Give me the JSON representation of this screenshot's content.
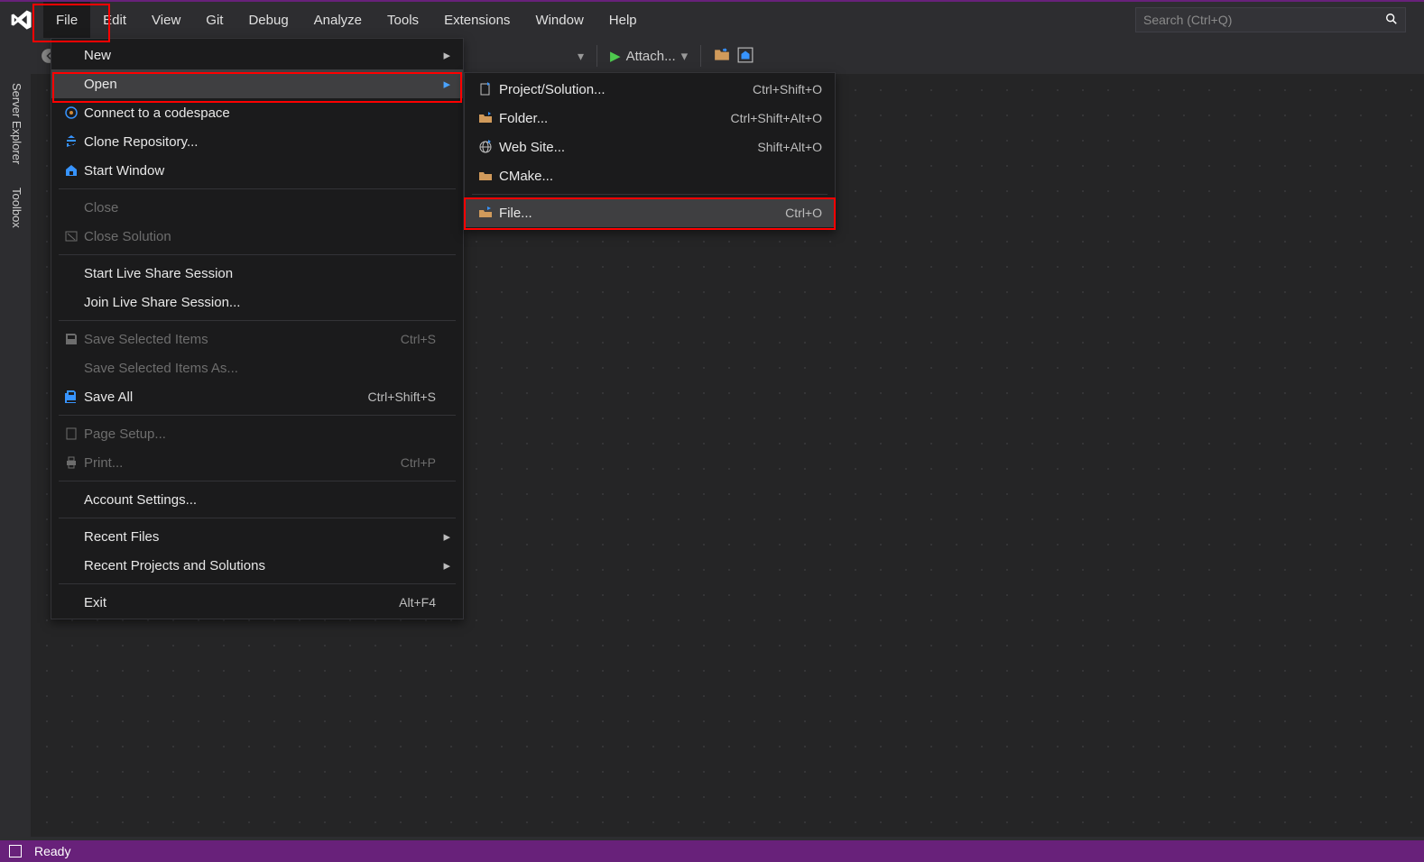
{
  "menubar": {
    "items": [
      "File",
      "Edit",
      "View",
      "Git",
      "Debug",
      "Analyze",
      "Tools",
      "Extensions",
      "Window",
      "Help"
    ],
    "search_placeholder": "Search (Ctrl+Q)"
  },
  "toolstrip": {
    "attach_label": "Attach..."
  },
  "sidetabs": [
    "Server Explorer",
    "Toolbox"
  ],
  "file_menu": {
    "new": {
      "label": "New"
    },
    "open": {
      "label": "Open"
    },
    "connect": {
      "label": "Connect to a codespace"
    },
    "clone": {
      "label": "Clone Repository..."
    },
    "startwin": {
      "label": "Start Window"
    },
    "close": {
      "label": "Close"
    },
    "closesln": {
      "label": "Close Solution"
    },
    "startlive": {
      "label": "Start Live Share Session"
    },
    "joinlive": {
      "label": "Join Live Share Session..."
    },
    "savesel": {
      "label": "Save Selected Items",
      "shortcut": "Ctrl+S"
    },
    "saveselas": {
      "label": "Save Selected Items As..."
    },
    "saveall": {
      "label": "Save All",
      "shortcut": "Ctrl+Shift+S"
    },
    "pagesetup": {
      "label": "Page Setup..."
    },
    "print": {
      "label": "Print...",
      "shortcut": "Ctrl+P"
    },
    "account": {
      "label": "Account Settings..."
    },
    "recentfiles": {
      "label": "Recent Files"
    },
    "recentproj": {
      "label": "Recent Projects and Solutions"
    },
    "exit": {
      "label": "Exit",
      "shortcut": "Alt+F4"
    }
  },
  "open_menu": {
    "project": {
      "label": "Project/Solution...",
      "shortcut": "Ctrl+Shift+O"
    },
    "folder": {
      "label": "Folder...",
      "shortcut": "Ctrl+Shift+Alt+O"
    },
    "website": {
      "label": "Web Site...",
      "shortcut": "Shift+Alt+O"
    },
    "cmake": {
      "label": "CMake..."
    },
    "file": {
      "label": "File...",
      "shortcut": "Ctrl+O"
    }
  },
  "status": {
    "text": "Ready"
  }
}
